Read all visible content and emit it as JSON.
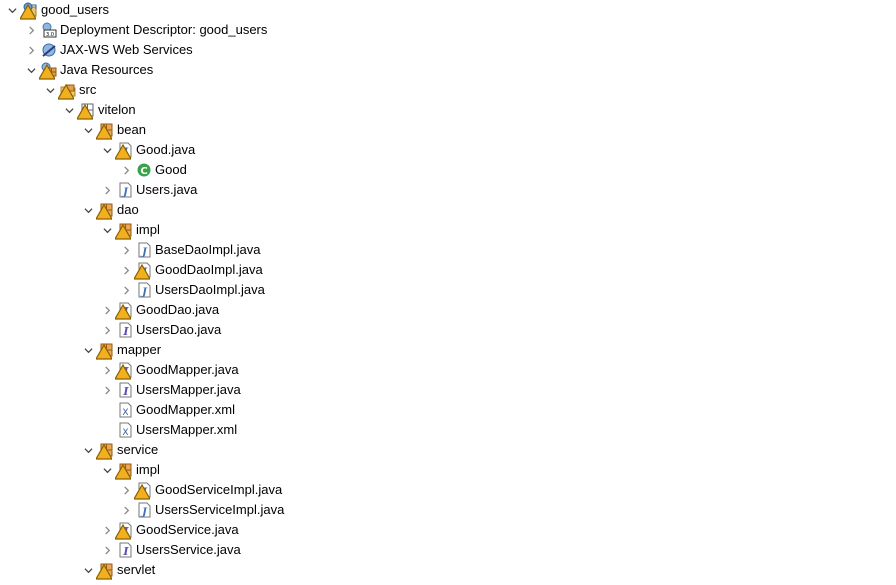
{
  "tree": {
    "rows": [
      {
        "level": 0,
        "label": "good_users",
        "icon": "project-icon",
        "state": "expanded",
        "warning": true
      },
      {
        "level": 1,
        "label": "Deployment Descriptor: good_users",
        "icon": "deployment-descriptor-icon",
        "state": "collapsed",
        "warning": false
      },
      {
        "level": 1,
        "label": "JAX-WS Web Services",
        "icon": "web-services-icon",
        "state": "collapsed",
        "warning": false
      },
      {
        "level": 1,
        "label": "Java Resources",
        "icon": "java-resources-icon",
        "state": "expanded",
        "warning": true
      },
      {
        "level": 2,
        "label": "src",
        "icon": "source-folder-icon",
        "state": "expanded",
        "warning": true
      },
      {
        "level": 3,
        "label": "vitelon",
        "icon": "package-empty-icon",
        "state": "expanded",
        "warning": true
      },
      {
        "level": 4,
        "label": "bean",
        "icon": "package-icon",
        "state": "expanded",
        "warning": true
      },
      {
        "level": 5,
        "label": "Good.java",
        "icon": "java-file-icon",
        "state": "expanded",
        "warning": true
      },
      {
        "level": 6,
        "label": "Good",
        "icon": "class-icon",
        "state": "collapsed",
        "warning": false
      },
      {
        "level": 5,
        "label": "Users.java",
        "icon": "java-file-icon",
        "state": "collapsed",
        "warning": false
      },
      {
        "level": 4,
        "label": "dao",
        "icon": "package-icon",
        "state": "expanded",
        "warning": true
      },
      {
        "level": 5,
        "label": "impl",
        "icon": "package-icon",
        "state": "expanded",
        "warning": true
      },
      {
        "level": 6,
        "label": "BaseDaoImpl.java",
        "icon": "java-file-icon",
        "state": "collapsed",
        "warning": false
      },
      {
        "level": 6,
        "label": "GoodDaoImpl.java",
        "icon": "java-file-icon",
        "state": "collapsed",
        "warning": true
      },
      {
        "level": 6,
        "label": "UsersDaoImpl.java",
        "icon": "java-file-icon",
        "state": "collapsed",
        "warning": false
      },
      {
        "level": 5,
        "label": "GoodDao.java",
        "icon": "interface-file-icon",
        "state": "collapsed",
        "warning": true
      },
      {
        "level": 5,
        "label": "UsersDao.java",
        "icon": "interface-file-icon",
        "state": "collapsed",
        "warning": false
      },
      {
        "level": 4,
        "label": "mapper",
        "icon": "package-icon",
        "state": "expanded",
        "warning": true
      },
      {
        "level": 5,
        "label": "GoodMapper.java",
        "icon": "interface-file-icon",
        "state": "collapsed",
        "warning": true
      },
      {
        "level": 5,
        "label": "UsersMapper.java",
        "icon": "interface-file-icon",
        "state": "collapsed",
        "warning": false
      },
      {
        "level": 5,
        "label": "GoodMapper.xml",
        "icon": "xml-file-icon",
        "state": "leaf",
        "warning": false
      },
      {
        "level": 5,
        "label": "UsersMapper.xml",
        "icon": "xml-file-icon",
        "state": "leaf",
        "warning": false
      },
      {
        "level": 4,
        "label": "service",
        "icon": "package-icon",
        "state": "expanded",
        "warning": true
      },
      {
        "level": 5,
        "label": "impl",
        "icon": "package-icon",
        "state": "expanded",
        "warning": true
      },
      {
        "level": 6,
        "label": "GoodServiceImpl.java",
        "icon": "java-file-icon",
        "state": "collapsed",
        "warning": true
      },
      {
        "level": 6,
        "label": "UsersServiceImpl.java",
        "icon": "java-file-icon",
        "state": "collapsed",
        "warning": false
      },
      {
        "level": 5,
        "label": "GoodService.java",
        "icon": "interface-file-icon",
        "state": "collapsed",
        "warning": true
      },
      {
        "level": 5,
        "label": "UsersService.java",
        "icon": "interface-file-icon",
        "state": "collapsed",
        "warning": false
      },
      {
        "level": 4,
        "label": "servlet",
        "icon": "package-icon",
        "state": "expanded",
        "warning": true
      }
    ]
  },
  "colors": {
    "warning": "#f2b01e",
    "package": "#c9822b",
    "java": "#3f6fb5",
    "class": "#3aa34a",
    "interface": "#5a4fb0"
  }
}
